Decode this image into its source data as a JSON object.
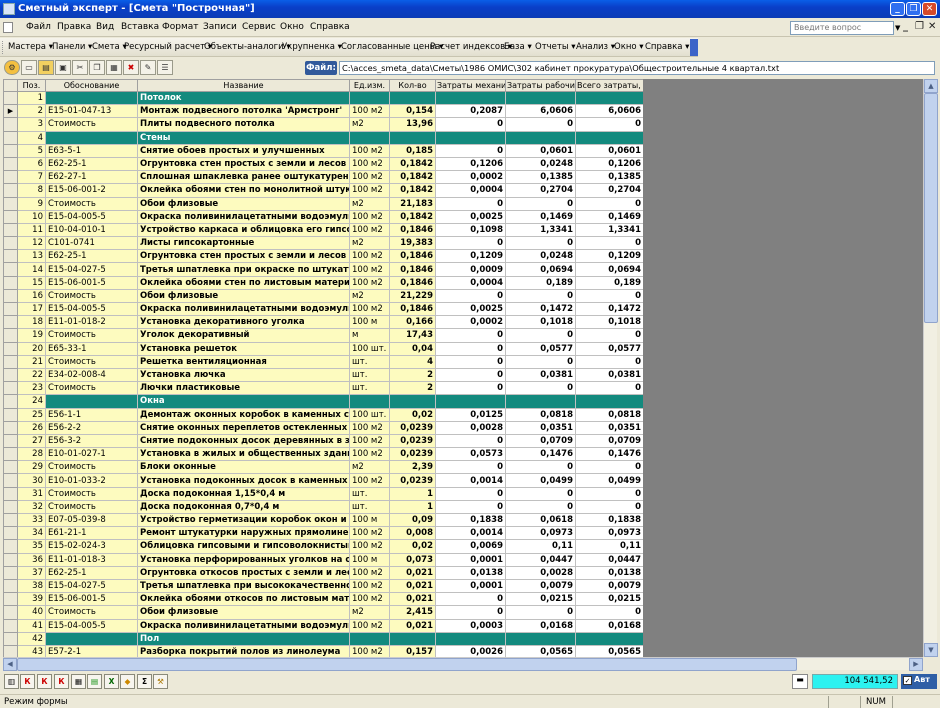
{
  "window": {
    "title": "Сметный эксперт - [Смета \"Построчная\"]"
  },
  "menu": {
    "items": [
      "Файл",
      "Правка",
      "Вид",
      "Вставка",
      "Формат",
      "Записи",
      "Сервис",
      "Окно",
      "Справка"
    ],
    "ask_placeholder": "Введите вопрос"
  },
  "toolbar2": {
    "items": [
      "Мастера ▾",
      "Панели ▾",
      "Смета ▾",
      "Ресурсный расчет ▾",
      "Объекты-аналоги ▾",
      "Укрупненка ▾",
      "Согласованные цены ▾",
      "Расчет индексов ▾",
      "База ▾",
      "Отчеты ▾",
      "Анализ ▾",
      "Окно ▾",
      "Справка ▾"
    ]
  },
  "file": {
    "label": "Файл:",
    "path": "C:\\acces_smeta_data\\Сметы\\1986 ОМИС\\302 кабинет прокуратура\\Общестроительные 4 квартал.txt"
  },
  "table": {
    "columns": [
      "Поз.",
      "Обоснование",
      "Название",
      "Ед.изм.",
      "Кол-во",
      "Затраты механиз",
      "Затраты рабочих",
      "Всего затраты, д"
    ],
    "rows": [
      {
        "type": "sec",
        "pos": "1",
        "name": "Потолок"
      },
      {
        "type": "row",
        "pos": "2",
        "code": "Е15-01-047-13",
        "name": "Монтаж подвесного потолка 'Армстронг'",
        "unit": "100 м2",
        "qty": "0,154",
        "mech": "0,2087",
        "work": "6,0606",
        "total": "6,0606",
        "cur": true
      },
      {
        "type": "row",
        "pos": "3",
        "code": "Стоимость",
        "name": "Плиты подвесного потолка",
        "unit": "м2",
        "qty": "13,96",
        "mech": "0",
        "work": "0",
        "total": "0"
      },
      {
        "type": "sec",
        "pos": "4",
        "name": "Стены"
      },
      {
        "type": "row",
        "pos": "5",
        "code": "Е63-5-1",
        "name": "Снятие обоев простых и улучшенных",
        "unit": "100 м2",
        "qty": "0,185",
        "mech": "0",
        "work": "0,0601",
        "total": "0,0601"
      },
      {
        "type": "row",
        "pos": "6",
        "code": "Е62-25-1",
        "name": "Огрунтовка стен простых с земли и лесов",
        "unit": "100 м2",
        "qty": "0,1842",
        "mech": "0,1206",
        "work": "0,0248",
        "total": "0,1206"
      },
      {
        "type": "row",
        "pos": "7",
        "code": "Е62-27-1",
        "name": "Сплошная шпаклевка ранее оштукатуренных по",
        "unit": "100 м2",
        "qty": "0,1842",
        "mech": "0,0002",
        "work": "0,1385",
        "total": "0,1385"
      },
      {
        "type": "row",
        "pos": "8",
        "code": "Е15-06-001-2",
        "name": "Оклейка обоями стен по монолитной штукатурке",
        "unit": "100 м2",
        "qty": "0,1842",
        "mech": "0,0004",
        "work": "0,2704",
        "total": "0,2704"
      },
      {
        "type": "row",
        "pos": "9",
        "code": "Стоимость",
        "name": "Обои флизовые",
        "unit": "м2",
        "qty": "21,183",
        "mech": "0",
        "work": "0",
        "total": "0"
      },
      {
        "type": "row",
        "pos": "10",
        "code": "Е15-04-005-5",
        "name": "Окраска поливинилацетатными водоэмульсион",
        "unit": "100 м2",
        "qty": "0,1842",
        "mech": "0,0025",
        "work": "0,1469",
        "total": "0,1469"
      },
      {
        "type": "row",
        "pos": "11",
        "code": "Е10-04-010-1",
        "name": "Устройство каркаса и облицовка его гипсокарто",
        "unit": "100 м2",
        "qty": "0,1846",
        "mech": "0,1098",
        "work": "1,3341",
        "total": "1,3341"
      },
      {
        "type": "row",
        "pos": "12",
        "code": "С101-0741",
        "name": "Листы гипсокартонные",
        "unit": "м2",
        "qty": "19,383",
        "mech": "0",
        "work": "0",
        "total": "0"
      },
      {
        "type": "row",
        "pos": "13",
        "code": "Е62-25-1",
        "name": "Огрунтовка стен простых с земли и лесов",
        "unit": "100 м2",
        "qty": "0,1846",
        "mech": "0,1209",
        "work": "0,0248",
        "total": "0,1209"
      },
      {
        "type": "row",
        "pos": "14",
        "code": "Е15-04-027-5",
        "name": "Третья шпатлевка при окраске по штукатурке и",
        "unit": "100 м2",
        "qty": "0,1846",
        "mech": "0,0009",
        "work": "0,0694",
        "total": "0,0694"
      },
      {
        "type": "row",
        "pos": "15",
        "code": "Е15-06-001-5",
        "name": "Оклейка обоями стен по листовым материалам, в",
        "unit": "100 м2",
        "qty": "0,1846",
        "mech": "0,0004",
        "work": "0,189",
        "total": "0,189"
      },
      {
        "type": "row",
        "pos": "16",
        "code": "Стоимость",
        "name": "Обои флизовые",
        "unit": "м2",
        "qty": "21,229",
        "mech": "0",
        "work": "0",
        "total": "0"
      },
      {
        "type": "row",
        "pos": "17",
        "code": "Е15-04-005-5",
        "name": "Окраска поливинилацетатными водоэмульсион",
        "unit": "100 м2",
        "qty": "0,1846",
        "mech": "0,0025",
        "work": "0,1472",
        "total": "0,1472"
      },
      {
        "type": "row",
        "pos": "18",
        "code": "Е11-01-018-2",
        "name": "Установка декоративного уголка",
        "unit": "100 м",
        "qty": "0,166",
        "mech": "0,0002",
        "work": "0,1018",
        "total": "0,1018"
      },
      {
        "type": "row",
        "pos": "19",
        "code": "Стоимость",
        "name": "Уголок декоративный",
        "unit": "м",
        "qty": "17,43",
        "mech": "0",
        "work": "0",
        "total": "0"
      },
      {
        "type": "row",
        "pos": "20",
        "code": "Е65-33-1",
        "name": "Установка решеток",
        "unit": "100 шт.",
        "qty": "0,04",
        "mech": "0",
        "work": "0,0577",
        "total": "0,0577"
      },
      {
        "type": "row",
        "pos": "21",
        "code": "Стоимость",
        "name": "Решетка вентиляционная",
        "unit": "шт.",
        "qty": "4",
        "mech": "0",
        "work": "0",
        "total": "0"
      },
      {
        "type": "row",
        "pos": "22",
        "code": "Е34-02-008-4",
        "name": "Установка лючка",
        "unit": "шт.",
        "qty": "2",
        "mech": "0",
        "work": "0,0381",
        "total": "0,0381"
      },
      {
        "type": "row",
        "pos": "23",
        "code": "Стоимость",
        "name": "Лючки пластиковые",
        "unit": "шт.",
        "qty": "2",
        "mech": "0",
        "work": "0",
        "total": "0"
      },
      {
        "type": "sec",
        "pos": "24",
        "name": "Окна"
      },
      {
        "type": "row",
        "pos": "25",
        "code": "Е56-1-1",
        "name": "Демонтаж оконных коробок в каменных стенах",
        "unit": "100 шт.",
        "qty": "0,02",
        "mech": "0,0125",
        "work": "0,0818",
        "total": "0,0818"
      },
      {
        "type": "row",
        "pos": "26",
        "code": "Е56-2-2",
        "name": "Снятие оконных переплетов остекленных",
        "unit": "100 м2",
        "qty": "0,0239",
        "mech": "0,0028",
        "work": "0,0351",
        "total": "0,0351"
      },
      {
        "type": "row",
        "pos": "27",
        "code": "Е56-3-2",
        "name": "Снятие подоконных досок деревянных в здании",
        "unit": "100 м2",
        "qty": "0,0239",
        "mech": "0",
        "work": "0,0709",
        "total": "0,0709"
      },
      {
        "type": "row",
        "pos": "28",
        "code": "Е10-01-027-1",
        "name": "Установка в жилых и общественных зданиях бл",
        "unit": "100 м2",
        "qty": "0,0239",
        "mech": "0,0573",
        "work": "0,1476",
        "total": "0,1476"
      },
      {
        "type": "row",
        "pos": "29",
        "code": "Стоимость",
        "name": "Блоки оконные",
        "unit": "м2",
        "qty": "2,39",
        "mech": "0",
        "work": "0",
        "total": "0"
      },
      {
        "type": "row",
        "pos": "30",
        "code": "Е10-01-033-2",
        "name": "Установка подоконных досок в каменных стена",
        "unit": "100 м2",
        "qty": "0,0239",
        "mech": "0,0014",
        "work": "0,0499",
        "total": "0,0499"
      },
      {
        "type": "row",
        "pos": "31",
        "code": "Стоимость",
        "name": "Доска подоконная 1,15*0,4 м",
        "unit": "шт.",
        "qty": "1",
        "mech": "0",
        "work": "0",
        "total": "0"
      },
      {
        "type": "row",
        "pos": "32",
        "code": "Стоимость",
        "name": "Доска подоконная 0,7*0,4 м",
        "unit": "шт.",
        "qty": "1",
        "mech": "0",
        "work": "0",
        "total": "0"
      },
      {
        "type": "row",
        "pos": "33",
        "code": "Е07-05-039-8",
        "name": "Устройство герметизации коробок окон и балкон",
        "unit": "100 м",
        "qty": "0,09",
        "mech": "0,1838",
        "work": "0,0618",
        "total": "0,1838"
      },
      {
        "type": "row",
        "pos": "34",
        "code": "Е61-21-1",
        "name": "Ремонт штукатурки наружных прямолинейных о",
        "unit": "100 м2",
        "qty": "0,008",
        "mech": "0,0014",
        "work": "0,0973",
        "total": "0,0973"
      },
      {
        "type": "row",
        "pos": "35",
        "code": "Е15-02-024-3",
        "name": "Облицовка гипсовыми и гипсоволокнистыми лист",
        "unit": "100 м2",
        "qty": "0,02",
        "mech": "0,0069",
        "work": "0,11",
        "total": "0,11"
      },
      {
        "type": "row",
        "pos": "36",
        "code": "Е11-01-018-3",
        "name": "Установка перфорированных уголков на откосы",
        "unit": "100 м",
        "qty": "0,073",
        "mech": "0,0001",
        "work": "0,0447",
        "total": "0,0447"
      },
      {
        "type": "row",
        "pos": "37",
        "code": "Е62-25-1",
        "name": "Огрунтовка откосов простых с земли и лесов",
        "unit": "100 м2",
        "qty": "0,021",
        "mech": "0,0138",
        "work": "0,0028",
        "total": "0,0138"
      },
      {
        "type": "row",
        "pos": "38",
        "code": "Е15-04-027-5",
        "name": "Третья шпатлевка при высококачественной окр",
        "unit": "100 м2",
        "qty": "0,021",
        "mech": "0,0001",
        "work": "0,0079",
        "total": "0,0079"
      },
      {
        "type": "row",
        "pos": "39",
        "code": "Е15-06-001-5",
        "name": "Оклейка обоями откосов по листовым материала",
        "unit": "100 м2",
        "qty": "0,021",
        "mech": "0",
        "work": "0,0215",
        "total": "0,0215"
      },
      {
        "type": "row",
        "pos": "40",
        "code": "Стоимость",
        "name": "Обои флизовые",
        "unit": "м2",
        "qty": "2,415",
        "mech": "0",
        "work": "0",
        "total": "0"
      },
      {
        "type": "row",
        "pos": "41",
        "code": "Е15-04-005-5",
        "name": "Окраска поливинилацетатными водоэмульсион",
        "unit": "100 м2",
        "qty": "0,021",
        "mech": "0,0003",
        "work": "0,0168",
        "total": "0,0168"
      },
      {
        "type": "sec",
        "pos": "42",
        "name": "Пол"
      },
      {
        "type": "row",
        "pos": "43",
        "code": "Е57-2-1",
        "name": "Разборка покрытий полов из линолеума",
        "unit": "100 м2",
        "qty": "0,157",
        "mech": "0,0026",
        "work": "0,0565",
        "total": "0,0565"
      }
    ]
  },
  "bottom": {
    "buttons": [
      "К",
      "К",
      "К"
    ],
    "total": "104 541,52",
    "avt": "Авт",
    "avt_checked": "✓"
  },
  "status": {
    "mode": "Режим формы",
    "num": "NUM"
  }
}
